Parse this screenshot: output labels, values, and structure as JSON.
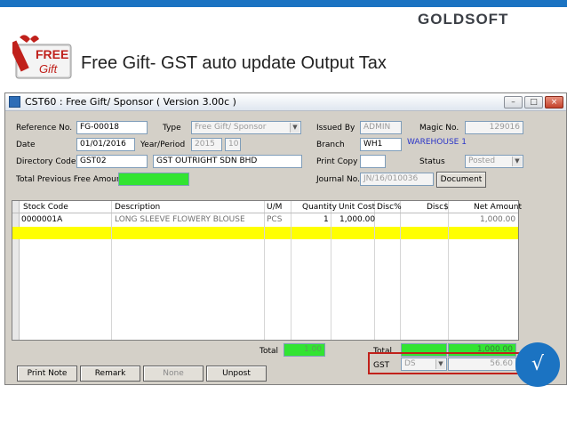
{
  "slide": {
    "brand_a": "GOLD",
    "brand_b": "SOFT",
    "title": "Free Gift- GST auto update Output Tax",
    "gift_text_top": "FREE",
    "gift_text_bottom": "Gift",
    "check_mark": "√"
  },
  "window": {
    "title": "CST60 : Free Gift/ Sponsor ( Version 3.00c )",
    "buttons": [
      "–",
      "□",
      "×"
    ]
  },
  "form": {
    "reference_label": "Reference No.",
    "reference_value": "FG-00018",
    "type_label": "Type",
    "type_value": "Free Gift/ Sponsor",
    "issued_by_label": "Issued By",
    "issued_by_value": "ADMIN",
    "magic_label": "Magic No.",
    "magic_value": "129016",
    "date_label": "Date",
    "date_value": "01/01/2016",
    "year_period_label": "Year/Period",
    "year_value": "2015",
    "period_value": "10",
    "branch_label": "Branch",
    "branch_value": "WH1",
    "branch_name": "WAREHOUSE 1",
    "directory_label": "Directory Code",
    "directory_code": "GST02",
    "directory_name": "GST OUTRIGHT SDN BHD",
    "print_copy_label": "Print Copy",
    "print_copy_value": "",
    "status_label": "Status",
    "status_value": "Posted",
    "journal_label": "Journal No.",
    "journal_value": "JN/16/010036",
    "document_button": "Document",
    "prev_free_label": "Total Previous Free Amount",
    "prev_free_value": ""
  },
  "grid": {
    "headers": [
      "Stock Code",
      "Description",
      "U/M",
      "Quantity",
      "Unit Cost",
      "Disc%",
      "Disc$",
      "Net Amount"
    ],
    "rows": [
      {
        "stock_code": "0000001A",
        "description": "LONG SLEEVE FLOWERY BLOUSE",
        "um": "PCS",
        "quantity": "1",
        "unit_cost": "1,000.00",
        "disc_pct": "",
        "disc_amt": "",
        "net_amount": "1,000.00"
      }
    ]
  },
  "footer": {
    "total_label_1": "Total",
    "total_qty": "1.00",
    "total_label_2": "Total",
    "total_amount": "1,000.00",
    "gst_label": "GST",
    "gst_code": "DS",
    "gst_amount": "56.60"
  },
  "actions": {
    "print_note": "Print Note",
    "remark": "Remark",
    "none": "None",
    "unpost": "Unpost"
  },
  "colors": {
    "accent_blue": "#1b73c2",
    "highlight_yellow": "#ffff00",
    "total_green": "#32e432",
    "annotation_red": "#c1211b"
  }
}
